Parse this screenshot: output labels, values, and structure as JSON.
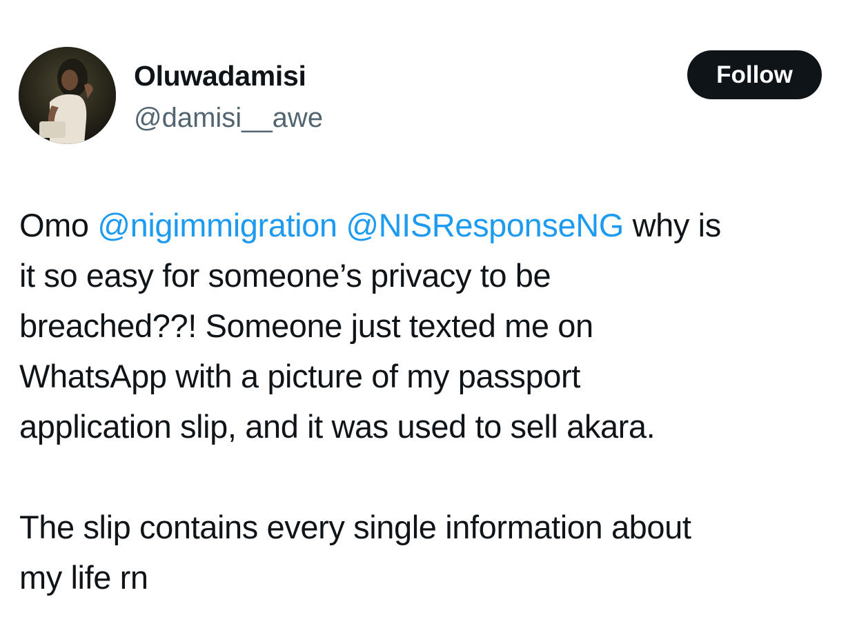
{
  "user": {
    "display_name": "Oluwadamisi",
    "handle": "@damisi__awe"
  },
  "follow_button": {
    "label": "Follow"
  },
  "tweet": {
    "paragraph1": {
      "intro": "Omo",
      "mention1": "@nigimmigration",
      "mention2": "@NISResponseNG",
      "line1_rest": "why is",
      "line2": "it so easy for someone’s privacy to be",
      "line3": "breached??! Someone just texted me on",
      "line4": "WhatsApp with a picture of my passport",
      "line5": "application slip, and it was used to sell akara."
    },
    "paragraph2": {
      "line1": "The slip contains every single information about",
      "line2": "my life rn"
    }
  },
  "colors": {
    "text": "#0f1419",
    "secondary_text": "#536471",
    "mention": "#1d9bf0",
    "button_bg": "#0f1419",
    "button_text": "#ffffff"
  }
}
